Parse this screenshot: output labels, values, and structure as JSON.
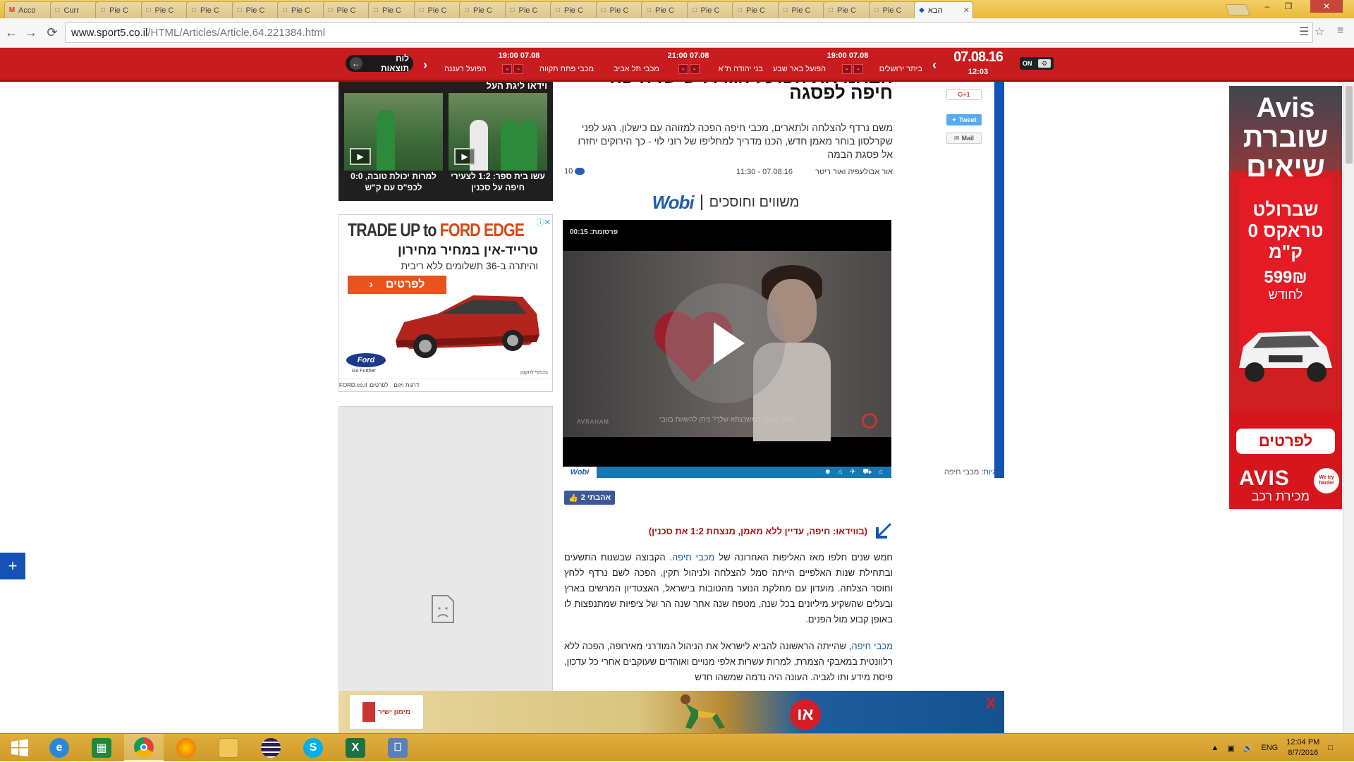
{
  "browser": {
    "tabs": [
      {
        "label": "Acco",
        "icon": "gmail-icon"
      },
      {
        "label": "Curr",
        "icon": "page-icon"
      },
      {
        "label": "Pie C",
        "icon": "page-icon"
      },
      {
        "label": "Pie C",
        "icon": "page-icon"
      },
      {
        "label": "Pie C",
        "icon": "page-icon"
      },
      {
        "label": "Pie C",
        "icon": "page-icon"
      },
      {
        "label": "Pie C",
        "icon": "page-icon"
      },
      {
        "label": "Pie C",
        "icon": "page-icon"
      },
      {
        "label": "Pie C",
        "icon": "page-icon"
      },
      {
        "label": "Pie C",
        "icon": "page-icon"
      },
      {
        "label": "Pie C",
        "icon": "page-icon"
      },
      {
        "label": "Pie C",
        "icon": "page-icon"
      },
      {
        "label": "Pie C",
        "icon": "page-icon"
      },
      {
        "label": "Pie C",
        "icon": "page-icon"
      },
      {
        "label": "Pie C",
        "icon": "page-icon"
      },
      {
        "label": "Pie C",
        "icon": "page-icon"
      },
      {
        "label": "Pie C",
        "icon": "page-icon"
      },
      {
        "label": "Pie C",
        "icon": "page-icon"
      },
      {
        "label": "Pie C",
        "icon": "page-icon"
      },
      {
        "label": "Pie C",
        "icon": "page-icon"
      },
      {
        "label": "הבא",
        "icon": "sport5-icon",
        "active": true
      }
    ],
    "url_host": "www.sport5.co.il",
    "url_path": "/HTML/Articles/Article.64.221384.html"
  },
  "header": {
    "results_label": "לוח תוצאות",
    "date": "07.08.16",
    "time": "12:03",
    "toggle_label": "ON",
    "matches": [
      {
        "time": "07.08 19:00",
        "home": "ביתר ירושלים",
        "away": "הפועל באר שבע",
        "home_score": "-",
        "away_score": "-"
      },
      {
        "time": "07.08 21:00",
        "home": "בני יהודה ת\"א",
        "away": "מכבי תל אביב",
        "home_score": "-",
        "away_score": "-"
      },
      {
        "time": "07.08 19:00",
        "home": "הפועל רעננה",
        "away": "מכבי פתח תקווה",
        "home_score": "-",
        "away_score": "-"
      }
    ]
  },
  "sidebar": {
    "video_widget_title": "וידאו ליגת העל",
    "videos": [
      {
        "caption": "עשו בית ספר: 1:2 לצעירי חיפה על סכנין"
      },
      {
        "caption": "למרות יכולת טובה, 0:0 לכפ\"ס עם ק\"ש"
      }
    ]
  },
  "ford_ad": {
    "line1_a": "TRADE UP to",
    "line1_b": "FORD EDGE",
    "line2": "טרייד-אין במחיר מחירון",
    "line3": "והיתרה ב-36 תשלומים ללא ריבית",
    "cta": "לפרטים",
    "logo": "Ford",
    "logo_sub": "Go Further",
    "small": "בכפוף לתקנון",
    "footer_brand": "דרגות ויזום",
    "footer_contact": "לפרטים: FORD.co.il"
  },
  "article": {
    "headline_top": "הבאנו את הפועל הגדול ש שו חיפה",
    "headline": "חיפה לפסגה",
    "subhead": "משם נרדף להצלחה ולתארים, מכבי חיפה הפכה למזוהה עם כישלון. רגע לפני שקרלסון בוחר מאמן חדש, הכנו מדריך למחליפו של רוני לוי - כך הירוקים יחזרו אל פסגת הבמה",
    "byline": "אור אבולעפיה ואור ריטר",
    "timestamp": "07.08.16 - 11:30",
    "comments": "10",
    "likes": "אהבתי 2",
    "video_link": "(בווידאו: חיפה, עדיין ללא מאמן, מנצחת 1:2 את סכנין)",
    "p1_a": "חמש שנים חלפו מאז האליפות האחרונה של ",
    "p1_link": "מכבי חיפה",
    "p1_b": ". הקבוצה שבשנות התשעים ובתחילת שנות האלפיים הייתה סמל להצלחה ולניהול תקין, הפכה לשם נרדף ללחץ וחוסר הצלחה. מועדון עם מחלקת הנוער מהטובות בישראל, האצטדיון המרשים בארץ ובעלים שהשקיע מיליונים בכל שנה, מטפח שנה אחר שנה הר של ציפיות שמתנפצות לו באופן קבוע מול הפנים.",
    "p2_link": "מכבי חיפה",
    "p2_b": ", שהייתה הראשונה להביא לישראל את הניהול המודרני מאירופה, הפכה ללא רלוונטית במאבקי הצמרת, למרות עשרות אלפי מנויים ואוהדים שעוקבים אחרי כל עדכון, פיסת מידע ותו לגביה. העונה היה נדמה שמשהו חדש"
  },
  "wobi": {
    "tagline": "משווים וחוסכים",
    "logo": "Wobi",
    "ad_label": "פרסומת: 00:15",
    "caption": "כמה מכבה המשכנתא שלך? ניתן להשוות בוובי",
    "brandmark": "AVRAHAM",
    "bar_logo": "Wobi"
  },
  "share": {
    "gplus": "G+1",
    "tweet": "Tweet",
    "mail": "Mail"
  },
  "tags": {
    "label": "תגיות:",
    "value": "מכבי חיפה"
  },
  "avis_ad": {
    "headline": "Avis שוברת שיאים",
    "offer": "שברולט טראקס 0 ק\"מ",
    "price": "599₪",
    "per": "לחודש",
    "cta": "לפרטים",
    "brand": "AVIS",
    "badge": "We try harder",
    "sub": "מכירת רכב"
  },
  "bottom_ad": {
    "brand": "מימון ישיר",
    "letter": "או",
    "close": "X"
  },
  "taskbar": {
    "apps": [
      "start-icon",
      "ie-icon",
      "store-icon",
      "chrome-icon",
      "firefox-icon",
      "explorer-icon",
      "eclipse-icon",
      "skype-icon",
      "excel-icon",
      "remote-desktop-icon"
    ],
    "lang": "ENG",
    "clock_time": "12:04 PM",
    "clock_date": "8/7/2016"
  },
  "colors": {
    "site_red": "#c91c1f",
    "site_blue": "#1453b5",
    "taskbar": "#d8a32f"
  }
}
